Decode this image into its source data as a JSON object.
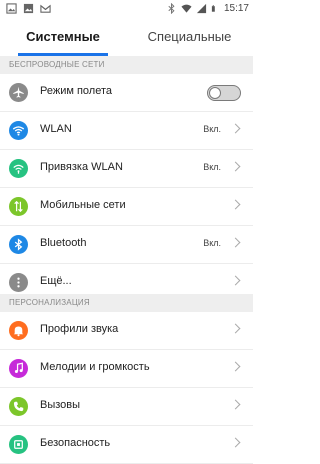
{
  "status_bar": {
    "time": "15:17",
    "left_icons": [
      "image-icon",
      "image-icon",
      "mail-icon"
    ],
    "right_icons": [
      "bluetooth-icon",
      "wifi-icon",
      "signal-icon",
      "battery-icon"
    ]
  },
  "tabs": [
    {
      "label": "Системные",
      "active": true
    },
    {
      "label": "Специальные",
      "active": false
    }
  ],
  "sections": [
    {
      "header": "БЕСПРОВОДНЫЕ СЕТИ",
      "items": [
        {
          "label": "Режим полета",
          "icon": "airplane-icon",
          "color": "#8a8a8a",
          "control": "toggle",
          "toggle_on": false
        },
        {
          "label": "WLAN",
          "icon": "wifi-icon",
          "color": "#1e88e5",
          "status": "Вкл."
        },
        {
          "label": "Привязка WLAN",
          "icon": "wifi-tether-icon",
          "color": "#26c281",
          "status": "Вкл."
        },
        {
          "label": "Мобильные сети",
          "icon": "mobile-data-icon",
          "color": "#7cc62a"
        },
        {
          "label": "Bluetooth",
          "icon": "bluetooth-icon",
          "color": "#1e88e5",
          "status": "Вкл."
        },
        {
          "label": "Ещё...",
          "icon": "more-icon",
          "color": "#8a8a8a"
        }
      ]
    },
    {
      "header": "ПЕРСОНАЛИЗАЦИЯ",
      "items": [
        {
          "label": "Профили звука",
          "icon": "bell-icon",
          "color": "#ff6d1f"
        },
        {
          "label": "Мелодии и громкость",
          "icon": "music-note-icon",
          "color": "#c62ad9"
        },
        {
          "label": "Вызовы",
          "icon": "phone-icon",
          "color": "#7cc62a"
        },
        {
          "label": "Безопасность",
          "icon": "security-icon",
          "color": "#26c281"
        }
      ]
    }
  ]
}
